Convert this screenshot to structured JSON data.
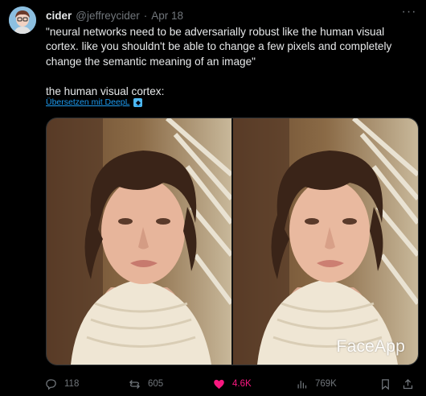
{
  "tweet": {
    "author_name": "cider",
    "author_handle": "@jeffreycider",
    "separator": "·",
    "date": "Apr 18",
    "more": "···",
    "text": "\"neural networks need to be adversarially robust like the human visual cortex. like you shouldn't be able to change a few pixels and completely change the semantic meaning of an image\"\n\nthe human visual cortex:",
    "translate_label": "Übersetzen mit DeepL"
  },
  "media": {
    "watermark": "FaceApp"
  },
  "actions": {
    "replies": "118",
    "retweets": "605",
    "likes": "4.6K",
    "views": "769K"
  },
  "colors": {
    "background": "#000000",
    "text": "#e7e9ea",
    "muted": "#71767b",
    "link": "#1d9bf0",
    "like": "#f91880"
  }
}
